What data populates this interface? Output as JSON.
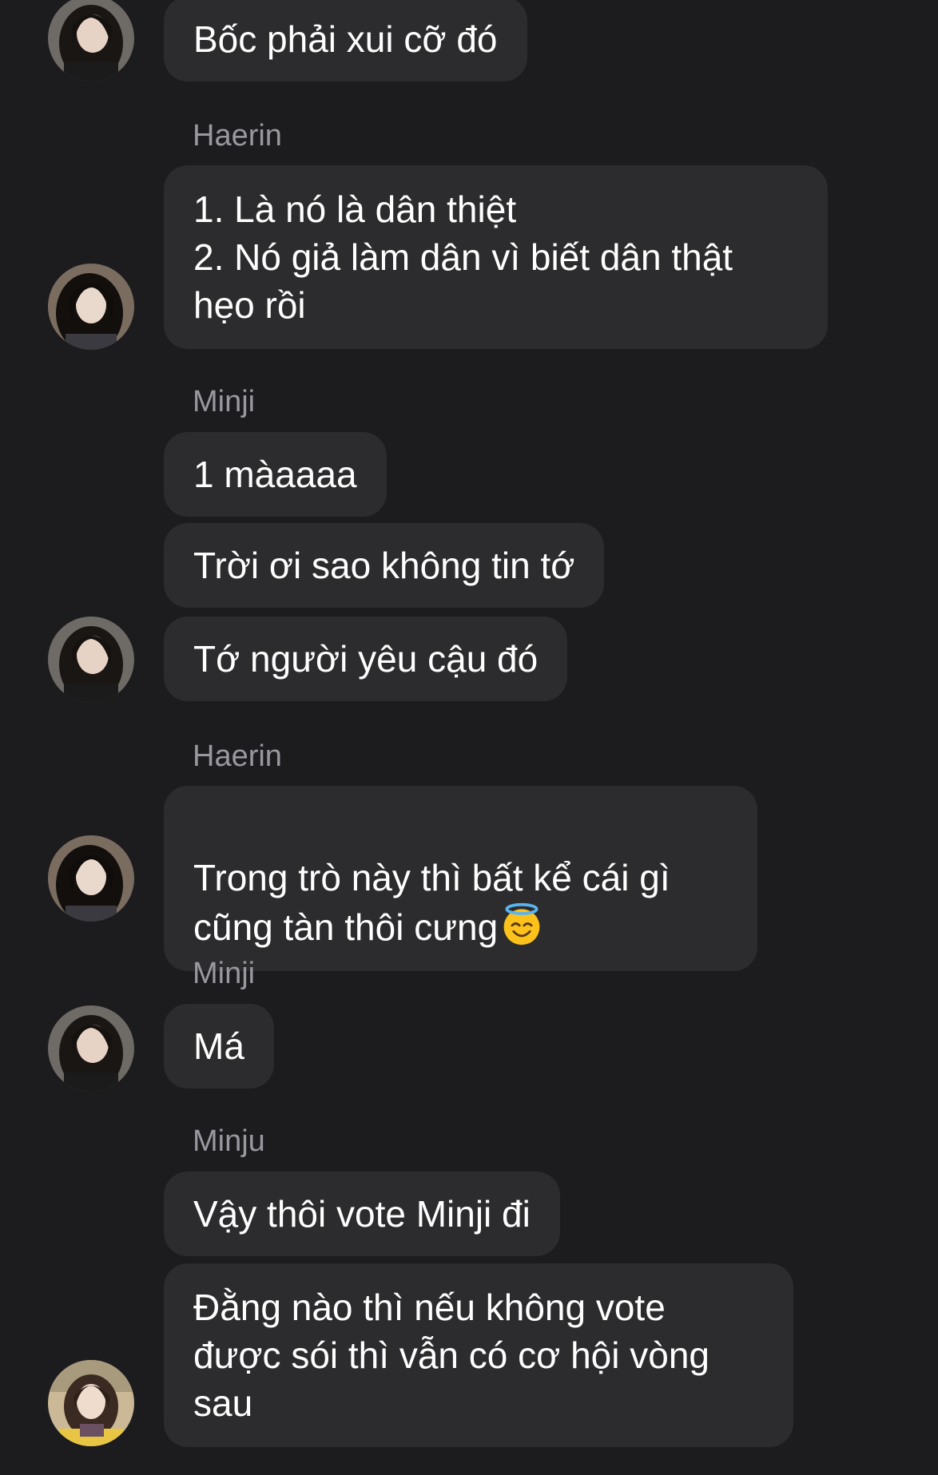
{
  "messages": [
    {
      "sender": "",
      "text": "Bốc phải xui cỡ đó"
    },
    {
      "sender": "Haerin",
      "text": "1. Là nó là dân thiệt\n2. Nó giả làm dân vì biết dân thật\nhẹo rồi"
    },
    {
      "sender": "Minji",
      "texts": [
        "1 màaaaa",
        "Trời ơi sao không tin tớ",
        "Tớ người yêu cậu đó"
      ]
    },
    {
      "sender": "Haerin",
      "text": "Trong trò này thì bất kể cái gì\ncũng tàn thôi cưng",
      "emoji": "smiling-face-with-halo-icon"
    },
    {
      "sender": "Minji",
      "text": "Má"
    },
    {
      "sender": "Minju",
      "texts": [
        "Vậy thôi vote Minji đi",
        "Đằng nào thì nếu không vote\nđược sói thì vẫn có cơ hội vòng\nsau"
      ]
    }
  ],
  "colors": {
    "background": "#1c1c1e",
    "bubble": "#2c2c2e",
    "sender_name": "#98989f",
    "text": "#ffffff"
  }
}
